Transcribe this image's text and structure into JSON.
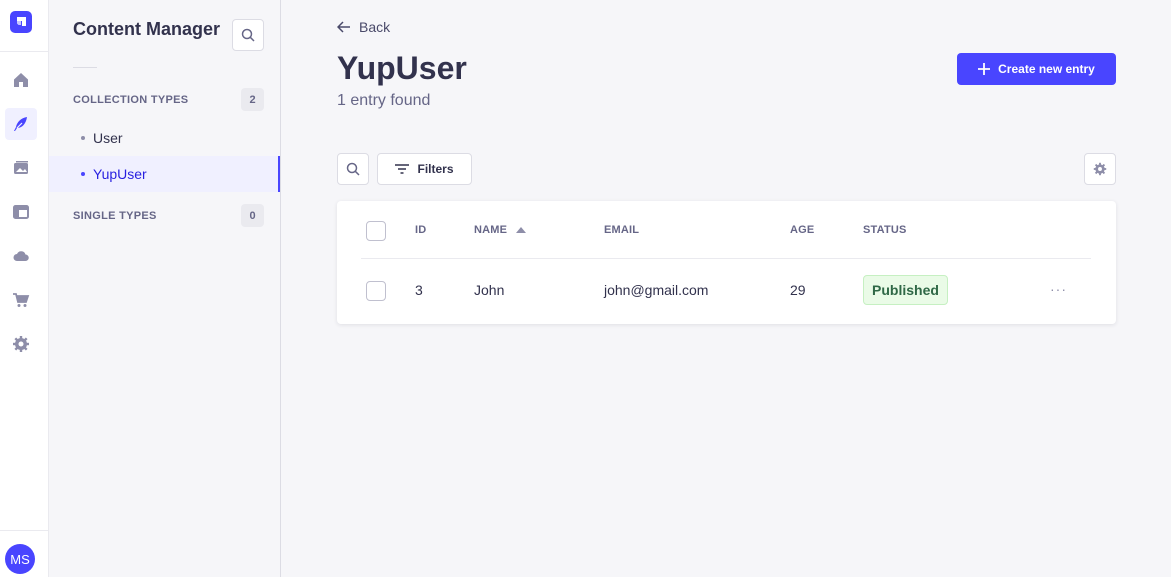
{
  "rail": {
    "items": [
      {
        "name": "home-icon",
        "active": false
      },
      {
        "name": "feather-icon",
        "active": true
      },
      {
        "name": "media-icon",
        "active": false
      },
      {
        "name": "layout-icon",
        "active": false
      },
      {
        "name": "cloud-icon",
        "active": false
      },
      {
        "name": "cart-icon",
        "active": false
      },
      {
        "name": "gear-icon",
        "active": false
      }
    ],
    "avatar_initials": "MS"
  },
  "subnav": {
    "title": "Content Manager",
    "collection_types": {
      "label": "COLLECTION TYPES",
      "count": "2",
      "items": [
        {
          "label": "User",
          "active": false
        },
        {
          "label": "YupUser",
          "active": true
        }
      ]
    },
    "single_types": {
      "label": "SINGLE TYPES",
      "count": "0"
    }
  },
  "header": {
    "back_label": "Back",
    "title": "YupUser",
    "subtitle": "1 entry found",
    "create_label": "Create new entry"
  },
  "toolbar": {
    "filters_label": "Filters"
  },
  "table": {
    "columns": [
      "ID",
      "NAME",
      "EMAIL",
      "AGE",
      "STATUS"
    ],
    "sorted_column": "NAME",
    "rows": [
      {
        "id": "3",
        "name": "John",
        "email": "john@gmail.com",
        "age": "29",
        "status": "Published",
        "more": "···"
      }
    ]
  },
  "colors": {
    "primary": "#4945ff",
    "published_bg": "#eafbe7",
    "published_text": "#2f6846"
  }
}
